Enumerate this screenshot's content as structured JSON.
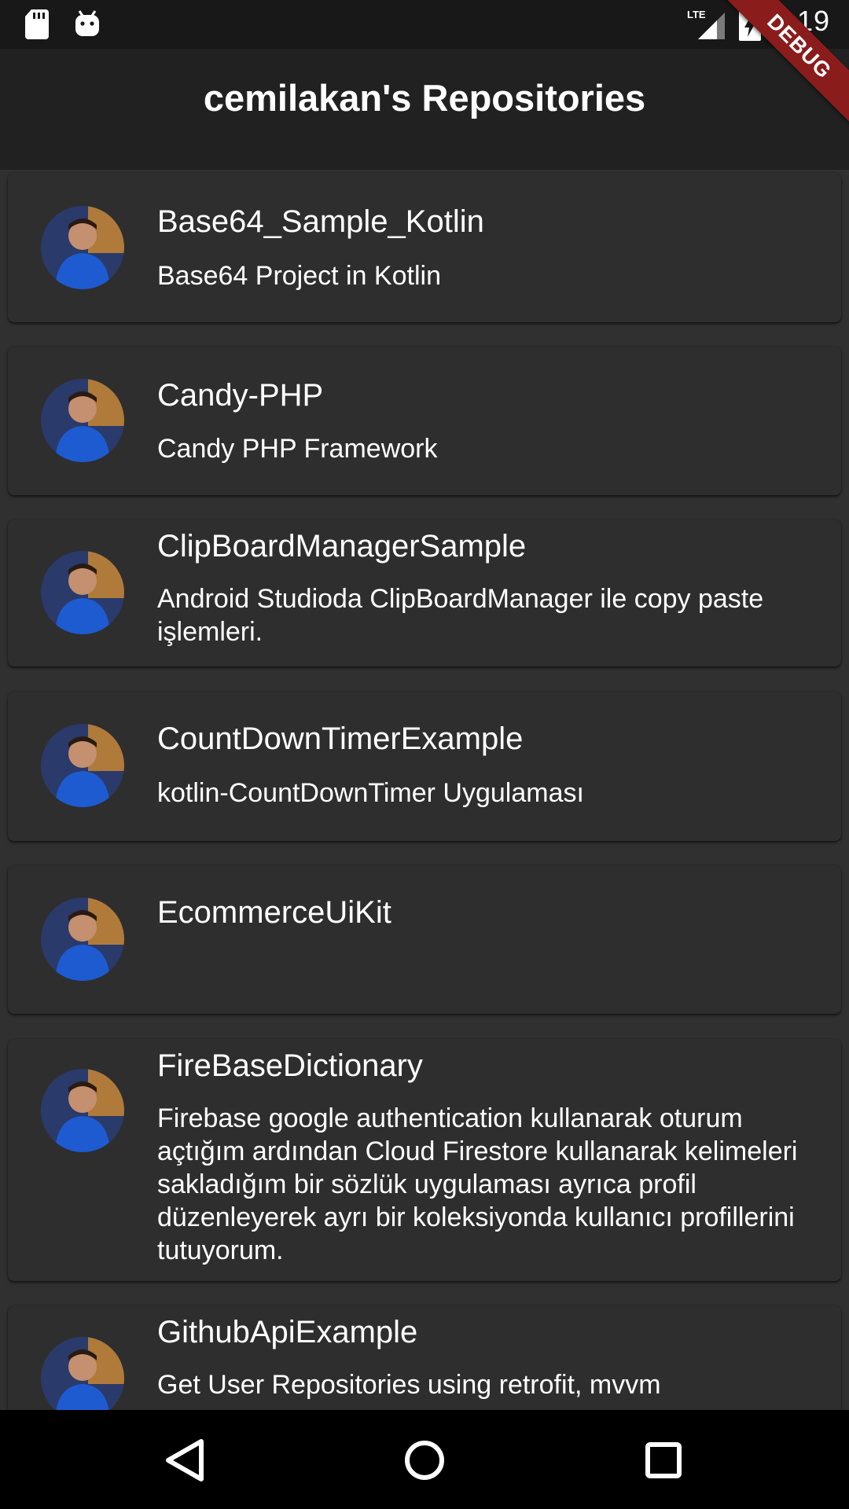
{
  "status_bar": {
    "time": "4:19",
    "network": "LTE",
    "icons": [
      "sd-card-icon",
      "android-icon",
      "lte-signal-icon",
      "battery-charging-icon"
    ]
  },
  "app_bar": {
    "title": "cemilakan's Repositories"
  },
  "debug_banner": "DEBUG",
  "repositories": [
    {
      "name": "Base64_Sample_Kotlin",
      "description": "Base64 Project in Kotlin"
    },
    {
      "name": "Candy-PHP",
      "description": "Candy PHP Framework"
    },
    {
      "name": "ClipBoardManagerSample",
      "description": "Android Studioda ClipBoardManager ile copy paste işlemleri."
    },
    {
      "name": "CountDownTimerExample",
      "description": "kotlin-CountDownTimer Uygulaması"
    },
    {
      "name": "EcommerceUiKit",
      "description": ""
    },
    {
      "name": "FireBaseDictionary",
      "description": "Firebase google authentication kullanarak oturum açtığım ardından Cloud Firestore kullanarak kelimeleri sakladığım bir sözlük uygulaması ayrıca profil düzenleyerek ayrı bir koleksiyonda kullanıcı profillerini tutuyorum."
    },
    {
      "name": "GithubApiExample",
      "description": "Get User Repositories using retrofit, mvvm"
    }
  ],
  "nav_bar": {
    "buttons": [
      "back-icon",
      "home-icon",
      "recents-icon"
    ]
  },
  "colors": {
    "background": "#303030",
    "card": "#2e2e2e",
    "app_bar": "#212121",
    "status_bar": "#181818",
    "debug_banner": "#8b1c1c"
  }
}
